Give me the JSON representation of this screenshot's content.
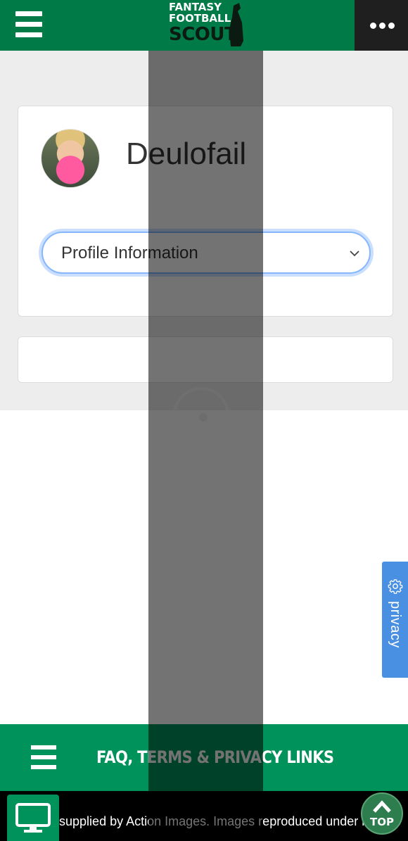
{
  "header": {
    "logo_line1": "FANTASY",
    "logo_line2": "FOOTBALL",
    "logo_line3": "SCOUT",
    "logo_name": "fantasy-football-scout-logo",
    "menu_icon": "hamburger-icon",
    "more_icon": "ellipsis-icon"
  },
  "profile": {
    "username": "Deulofail",
    "avatar_icon": "user-avatar",
    "select": {
      "selected": "Profile Information",
      "icon": "chevron-down-icon"
    }
  },
  "loader": {
    "icon": "loading-spinner-icon"
  },
  "privacy_tab": {
    "label": "privacy",
    "icon": "gear-icon"
  },
  "footer": {
    "links_label": "FAQ, TERMS & PRIVACY LINKS",
    "links_icon": "hamburger-icon",
    "credit": "Images supplied by Action Images. Images reproduced under licence",
    "desktop_icon": "desktop-icon",
    "top_label": "TOP",
    "top_icon": "chevron-up-icon"
  },
  "colors": {
    "header_bg": "#007a46",
    "footer_bg": "#00925b",
    "privacy_bg": "#4a90e2",
    "content_bg": "#ededed"
  }
}
